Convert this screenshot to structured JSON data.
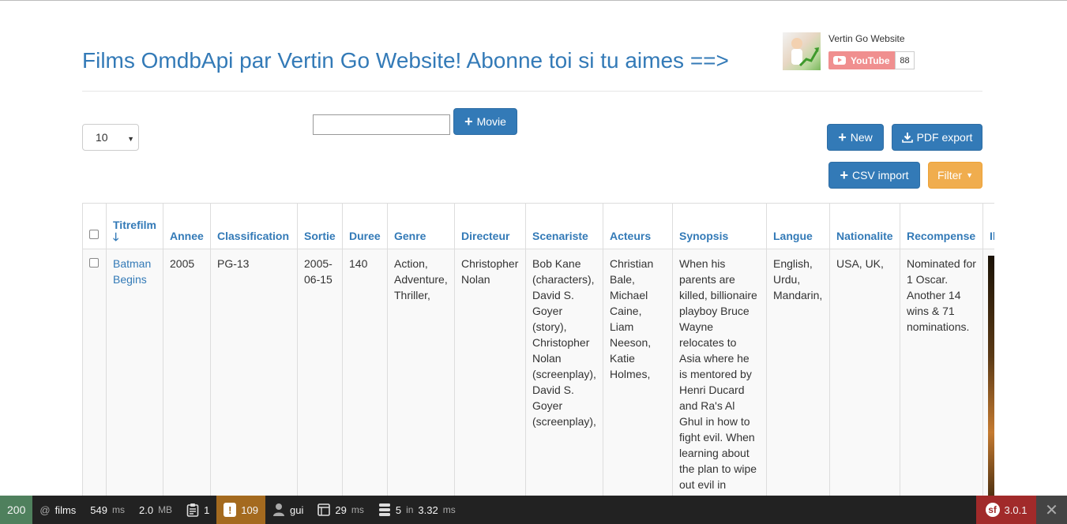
{
  "header": {
    "title": "Films OmdbApi par Vertin Go Website! Abonne toi si tu aimes ==>"
  },
  "youtube": {
    "channel": "Vertin Go Website",
    "button_label": "YouTube",
    "subscriber_count": "88"
  },
  "controls": {
    "per_page_value": "10",
    "movie_input_value": "",
    "add_movie_label": "Movie",
    "new_label": "New",
    "pdf_export_label": "PDF export",
    "csv_import_label": "CSV import",
    "filter_label": "Filter"
  },
  "table": {
    "columns": [
      "Titrefilm",
      "Annee",
      "Classification",
      "Sortie",
      "Duree",
      "Genre",
      "Directeur",
      "Scenariste",
      "Acteurs",
      "Synopsis",
      "Langue",
      "Nationalite",
      "Recompense",
      "Il"
    ],
    "rows": [
      {
        "titrefilm": "Batman Begins",
        "annee": "2005",
        "classification": "PG-13",
        "sortie": "2005-06-15",
        "duree": "140",
        "genre": "Action, Adventure, Thriller,",
        "directeur": "Christopher Nolan",
        "scenariste": "Bob Kane (characters), David S. Goyer (story), Christopher Nolan (screenplay), David S. Goyer (screenplay),",
        "acteurs": "Christian Bale, Michael Caine, Liam Neeson, Katie Holmes,",
        "synopsis": "When his parents are killed, billionaire playboy Bruce Wayne relocates to Asia where he is mentored by Henri Ducard and Ra's Al Ghul in how to fight evil. When learning about the plan to wipe out evil in",
        "langue": "English, Urdu, Mandarin,",
        "nationalite": "USA, UK,",
        "recompense": "Nominated for 1 Oscar. Another 14 wins & 71 nominations."
      }
    ]
  },
  "debug_bar": {
    "status": "200",
    "route": "films",
    "time": "549",
    "time_unit": "ms",
    "memory": "2.0",
    "memory_unit": "MB",
    "logs": "1",
    "warnings": "109",
    "user": "gui",
    "render_time": "29",
    "render_unit": "ms",
    "queries": "5",
    "queries_in": "in",
    "queries_time": "3.32",
    "queries_unit": "ms",
    "version": "3.0.1"
  }
}
